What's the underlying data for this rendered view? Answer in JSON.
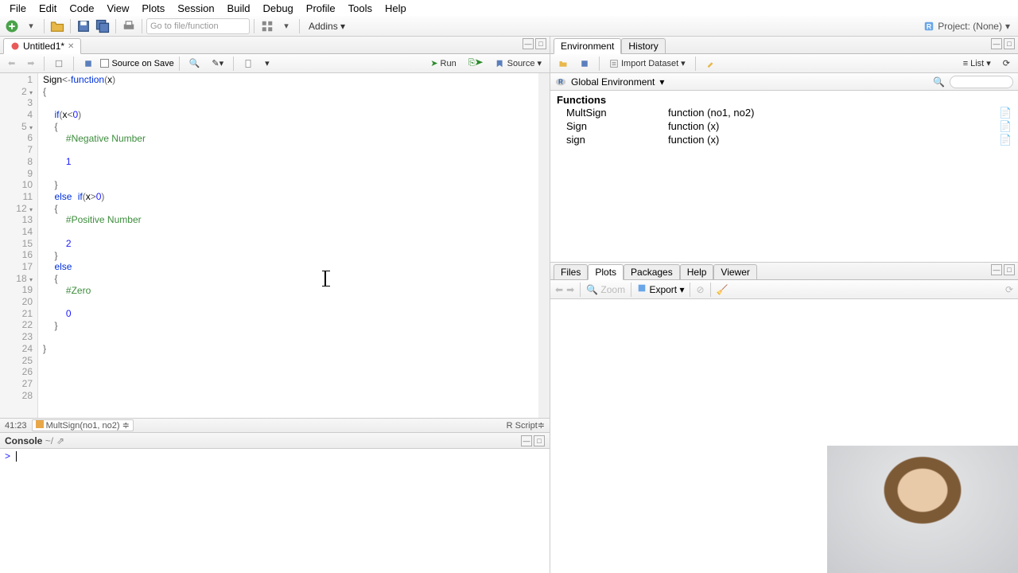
{
  "menu": {
    "file": "File",
    "edit": "Edit",
    "code": "Code",
    "view": "View",
    "plots": "Plots",
    "session": "Session",
    "build": "Build",
    "debug": "Debug",
    "profile": "Profile",
    "tools": "Tools",
    "help": "Help"
  },
  "toolbar": {
    "goto": "Go to file/function",
    "addins": "Addins",
    "project": "Project: (None)"
  },
  "source": {
    "tab": "Untitled1*",
    "source_on_save": "Source on Save",
    "run": "Run",
    "source_btn": "Source",
    "cursor_pos": "41:23",
    "crumb": "MultSign(no1, no2)",
    "lang": "R Script",
    "code_lines": [
      {
        "n": 1,
        "fold": "",
        "seg": [
          [
            "ident",
            "Sign"
          ],
          [
            "op",
            "<-"
          ],
          [
            "kw",
            "function"
          ],
          [
            "op",
            "("
          ],
          [
            "ident",
            "x"
          ],
          [
            "op",
            ")"
          ]
        ]
      },
      {
        "n": 2,
        "fold": "▾",
        "seg": [
          [
            "op",
            "{"
          ]
        ]
      },
      {
        "n": 3,
        "fold": "",
        "seg": [
          [
            "",
            "  "
          ]
        ]
      },
      {
        "n": 4,
        "fold": "",
        "seg": [
          [
            "",
            "  "
          ],
          [
            "kw",
            "if"
          ],
          [
            "op",
            "("
          ],
          [
            "ident",
            "x"
          ],
          [
            "op",
            "<"
          ],
          [
            "num",
            "0"
          ],
          [
            "op",
            ")"
          ]
        ]
      },
      {
        "n": 5,
        "fold": "▾",
        "seg": [
          [
            "",
            "  "
          ],
          [
            "op",
            "{"
          ]
        ]
      },
      {
        "n": 6,
        "fold": "",
        "seg": [
          [
            "",
            "    "
          ],
          [
            "com",
            "#Negative Number"
          ]
        ]
      },
      {
        "n": 7,
        "fold": "",
        "seg": [
          [
            "",
            "    "
          ]
        ]
      },
      {
        "n": 8,
        "fold": "",
        "seg": [
          [
            "",
            "    "
          ],
          [
            "num",
            "1"
          ]
        ]
      },
      {
        "n": 9,
        "fold": "",
        "seg": [
          [
            "",
            "    "
          ]
        ]
      },
      {
        "n": 10,
        "fold": "",
        "seg": [
          [
            "",
            "  "
          ],
          [
            "op",
            "}"
          ]
        ]
      },
      {
        "n": 11,
        "fold": "",
        "seg": [
          [
            "",
            "  "
          ],
          [
            "kw",
            "else"
          ],
          [
            "",
            " "
          ],
          [
            "kw",
            "if"
          ],
          [
            "op",
            "("
          ],
          [
            "ident",
            "x"
          ],
          [
            "op",
            ">"
          ],
          [
            "num",
            "0"
          ],
          [
            "op",
            ")"
          ]
        ]
      },
      {
        "n": 12,
        "fold": "▾",
        "seg": [
          [
            "",
            "  "
          ],
          [
            "op",
            "{"
          ]
        ]
      },
      {
        "n": 13,
        "fold": "",
        "seg": [
          [
            "",
            "    "
          ],
          [
            "com",
            "#Positive Number"
          ]
        ]
      },
      {
        "n": 14,
        "fold": "",
        "seg": [
          [
            "",
            "    "
          ]
        ]
      },
      {
        "n": 15,
        "fold": "",
        "seg": [
          [
            "",
            "    "
          ],
          [
            "num",
            "2"
          ]
        ]
      },
      {
        "n": 16,
        "fold": "",
        "seg": [
          [
            "",
            "  "
          ],
          [
            "op",
            "}"
          ]
        ]
      },
      {
        "n": 17,
        "fold": "",
        "seg": [
          [
            "",
            "  "
          ],
          [
            "kw",
            "else"
          ]
        ]
      },
      {
        "n": 18,
        "fold": "▾",
        "seg": [
          [
            "",
            "  "
          ],
          [
            "op",
            "{"
          ]
        ]
      },
      {
        "n": 19,
        "fold": "",
        "seg": [
          [
            "",
            "    "
          ],
          [
            "com",
            "#Zero"
          ]
        ]
      },
      {
        "n": 20,
        "fold": "",
        "seg": [
          [
            "",
            "    "
          ]
        ]
      },
      {
        "n": 21,
        "fold": "",
        "seg": [
          [
            "",
            "    "
          ],
          [
            "num",
            "0"
          ]
        ]
      },
      {
        "n": 22,
        "fold": "",
        "seg": [
          [
            "",
            "  "
          ],
          [
            "op",
            "}"
          ]
        ]
      },
      {
        "n": 23,
        "fold": "",
        "seg": [
          [
            "",
            "  "
          ]
        ]
      },
      {
        "n": 24,
        "fold": "",
        "seg": [
          [
            "op",
            "}"
          ]
        ]
      },
      {
        "n": 25,
        "fold": "",
        "seg": [
          [
            "",
            ""
          ]
        ]
      },
      {
        "n": 26,
        "fold": "",
        "seg": [
          [
            "",
            ""
          ]
        ]
      },
      {
        "n": 27,
        "fold": "",
        "seg": [
          [
            "",
            ""
          ]
        ]
      },
      {
        "n": 28,
        "fold": "",
        "seg": [
          [
            "",
            ""
          ]
        ]
      }
    ]
  },
  "console": {
    "title": "Console",
    "path": "~/",
    "prompt": ">"
  },
  "env": {
    "tab_env": "Environment",
    "tab_hist": "History",
    "import": "Import Dataset",
    "list": "List",
    "scope": "Global Environment",
    "heading": "Functions",
    "rows": [
      {
        "name": "MultSign",
        "val": "function (no1, no2)"
      },
      {
        "name": "Sign",
        "val": "function (x)"
      },
      {
        "name": "sign",
        "val": "function (x)"
      }
    ]
  },
  "plots": {
    "tabs": {
      "files": "Files",
      "plots": "Plots",
      "packages": "Packages",
      "help": "Help",
      "viewer": "Viewer"
    },
    "zoom": "Zoom",
    "export": "Export"
  }
}
